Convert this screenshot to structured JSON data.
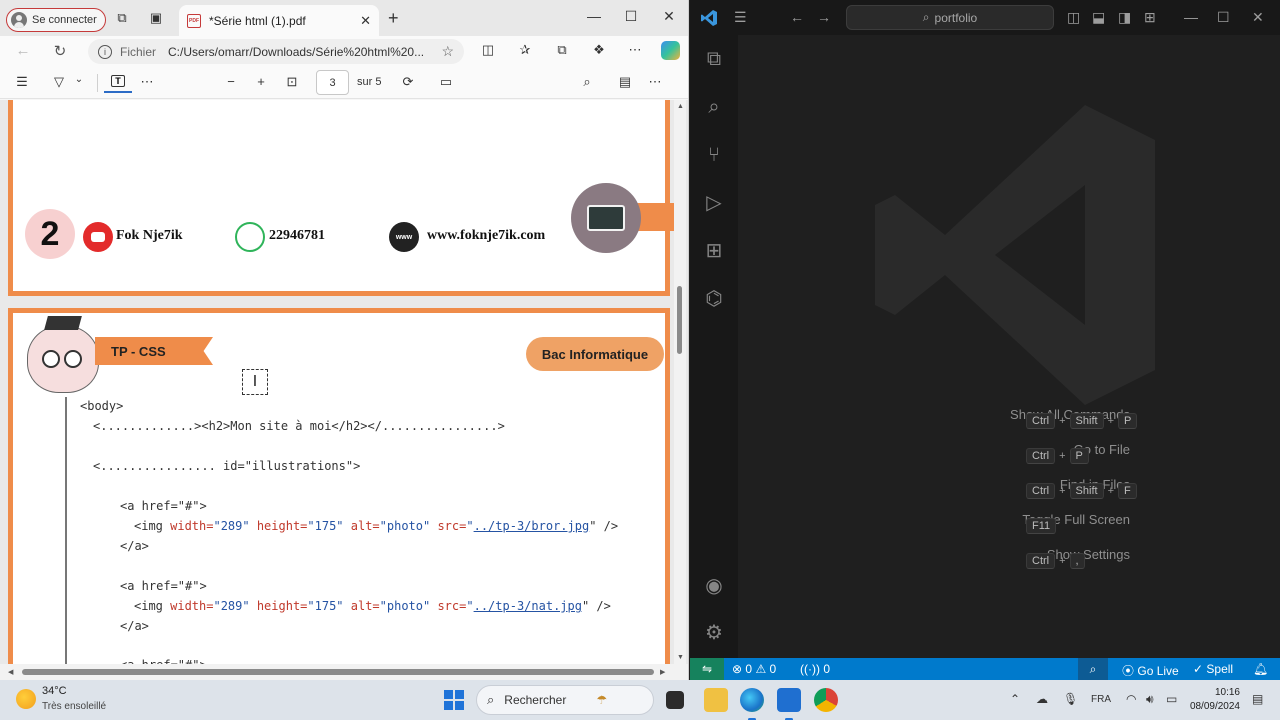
{
  "edge": {
    "profile_label": "Se connecter",
    "tab_title": "*Série html (1).pdf",
    "pdf_badge": "PDF",
    "address": {
      "origin_label": "Fichier",
      "url": "C:/Users/omarr/Downloads/Série%20html%20..."
    },
    "pdf_toolbar": {
      "page_current": "3",
      "page_total": "sur 5"
    }
  },
  "pdf_content": {
    "page1": {
      "page_number": "2",
      "youtube": "Fok Nje7ik",
      "whatsapp": "22946781",
      "website": "www.foknje7ik.com",
      "www_badge": "www"
    },
    "page2": {
      "tp_label": "TP - CSS",
      "bac_label": "Bac Informatique",
      "code_lines": [
        {
          "text": "<body>"
        },
        {
          "text": "<.............><h2>Mon site à moi</h2></................>"
        },
        {
          "text": "<................ id=\"illustrations\">"
        },
        {
          "text": "<a href=\"#\">"
        },
        {
          "img_pre": "<img ",
          "w_attr": "width=",
          "w_val": "\"289\"",
          "h_attr": " height=",
          "h_val": "\"175\"",
          "alt_attr": " alt=",
          "alt_val": "\"photo\"",
          "src_attr": " src=",
          "src_q": "\"",
          "src_link": "../tp-3/bror.jpg",
          "src_end": "\" />"
        },
        {
          "text": "</a>"
        },
        {
          "text": "<a href=\"#\">"
        },
        {
          "img_pre": "<img ",
          "w_attr": "width=",
          "w_val": "\"289\"",
          "h_attr": " height=",
          "h_val": "\"175\"",
          "alt_attr": " alt=",
          "alt_val": "\"photo\"",
          "src_attr": " src=",
          "src_q": "\"",
          "src_link": "../tp-3/nat.jpg",
          "src_end": "\" />"
        },
        {
          "text": "</a>"
        },
        {
          "text": "<a href=\"#\">"
        }
      ]
    }
  },
  "vscode": {
    "search_text": "portfolio",
    "commands": [
      {
        "label": "Show All Commands",
        "keys": [
          "Ctrl",
          "+",
          "Shift",
          "+",
          "P"
        ]
      },
      {
        "label": "Go to File",
        "keys": [
          "Ctrl",
          "+",
          "P"
        ]
      },
      {
        "label": "Find in Files",
        "keys": [
          "Ctrl",
          "+",
          "Shift",
          "+",
          "F"
        ]
      },
      {
        "label": "Toggle Full Screen",
        "keys": [
          "F11"
        ]
      },
      {
        "label": "Show Settings",
        "keys": [
          "Ctrl",
          "+",
          ","
        ]
      }
    ],
    "status": {
      "errors": "0",
      "warnings": "0",
      "ports": "0",
      "go_live": "Go Live",
      "spell": "Spell"
    }
  },
  "taskbar": {
    "temperature": "34°C",
    "weather": "Très ensoleillé",
    "search_placeholder": "Rechercher",
    "language": "FRA",
    "time": "10:16",
    "date": "08/09/2024"
  }
}
